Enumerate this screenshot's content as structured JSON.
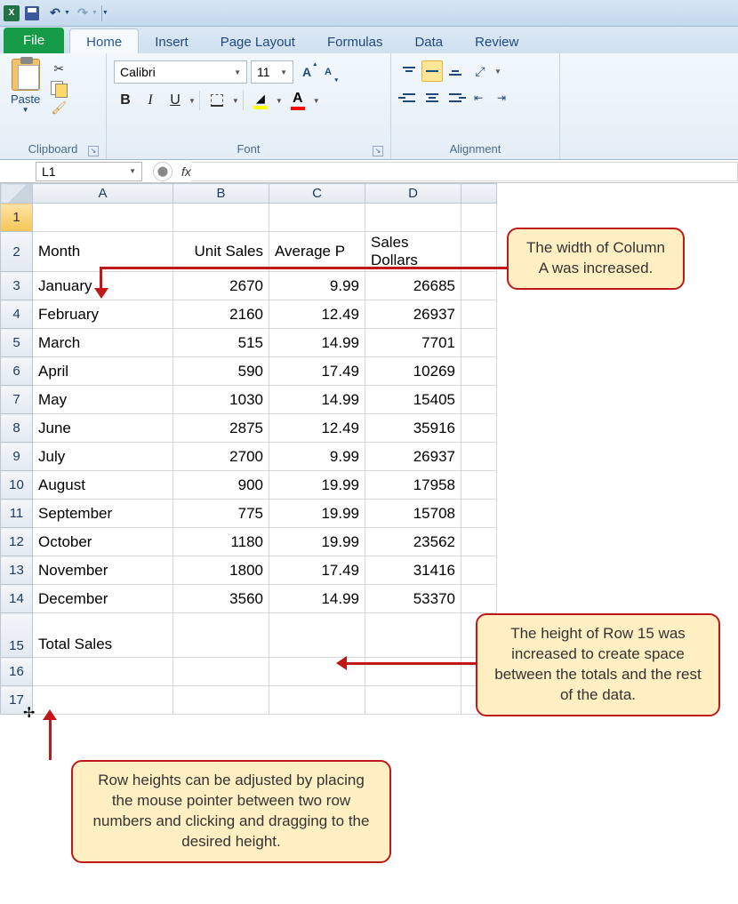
{
  "qat": {
    "app": "X",
    "save": "save",
    "undo": "↶",
    "redo": "↷"
  },
  "tabs": {
    "file": "File",
    "home": "Home",
    "insert": "Insert",
    "page_layout": "Page Layout",
    "formulas": "Formulas",
    "data": "Data",
    "review": "Review"
  },
  "ribbon": {
    "clipboard": {
      "paste": "Paste",
      "label": "Clipboard"
    },
    "font": {
      "name": "Calibri",
      "size": "11",
      "bold": "B",
      "italic": "I",
      "underline": "U",
      "grow": "A",
      "shrink": "A",
      "fill_letter": "🪣",
      "color_letter": "A",
      "label": "Font"
    },
    "alignment": {
      "label": "Alignment",
      "orient": "ab"
    }
  },
  "formula_bar": {
    "cell_ref": "L1",
    "fx": "fx"
  },
  "columns": [
    "A",
    "B",
    "C",
    "D"
  ],
  "rows": [
    "1",
    "2",
    "3",
    "4",
    "5",
    "6",
    "7",
    "8",
    "9",
    "10",
    "11",
    "12",
    "13",
    "14",
    "15",
    "16",
    "17"
  ],
  "headers": {
    "a": "Month",
    "b": "Unit Sales",
    "c": "Average P",
    "d": "Sales Dollars"
  },
  "data": [
    {
      "month": "January",
      "units": "2670",
      "price": "9.99",
      "dollars": "26685"
    },
    {
      "month": "February",
      "units": "2160",
      "price": "12.49",
      "dollars": "26937"
    },
    {
      "month": "March",
      "units": "515",
      "price": "14.99",
      "dollars": "7701"
    },
    {
      "month": "April",
      "units": "590",
      "price": "17.49",
      "dollars": "10269"
    },
    {
      "month": "May",
      "units": "1030",
      "price": "14.99",
      "dollars": "15405"
    },
    {
      "month": "June",
      "units": "2875",
      "price": "12.49",
      "dollars": "35916"
    },
    {
      "month": "July",
      "units": "2700",
      "price": "9.99",
      "dollars": "26937"
    },
    {
      "month": "August",
      "units": "900",
      "price": "19.99",
      "dollars": "17958"
    },
    {
      "month": "September",
      "units": "775",
      "price": "19.99",
      "dollars": "15708"
    },
    {
      "month": "October",
      "units": "1180",
      "price": "19.99",
      "dollars": "23562"
    },
    {
      "month": "November",
      "units": "1800",
      "price": "17.49",
      "dollars": "31416"
    },
    {
      "month": "December",
      "units": "3560",
      "price": "14.99",
      "dollars": "53370"
    }
  ],
  "total_label": "Total Sales",
  "callouts": {
    "col_a": "The width of Column A was increased.",
    "row_15": "The height of Row 15 was increased to create space between the totals and the rest of the data.",
    "row_heights": "Row heights can be adjusted by placing the mouse pointer between two row numbers and clicking and dragging to the desired height."
  }
}
